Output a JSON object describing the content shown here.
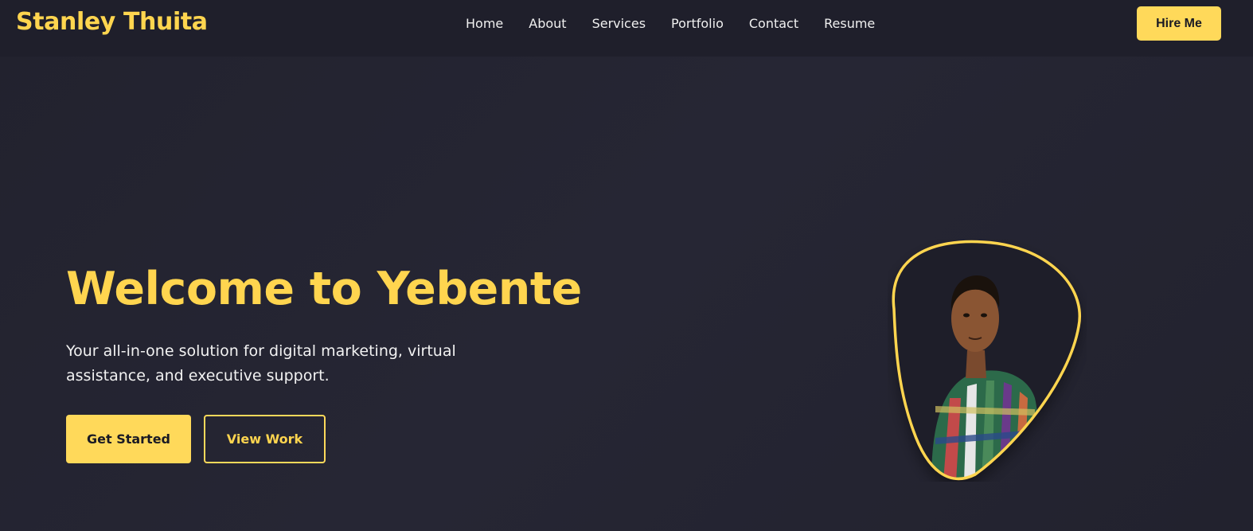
{
  "brand": {
    "name": "Stanley Thuita"
  },
  "nav": {
    "items": [
      {
        "label": "Home"
      },
      {
        "label": "About"
      },
      {
        "label": "Services"
      },
      {
        "label": "Portfolio"
      },
      {
        "label": "Contact"
      },
      {
        "label": "Resume"
      }
    ],
    "cta_label": "Hire Me"
  },
  "hero": {
    "title": "Welcome to Yebente",
    "subtitle": "Your all-in-one solution for digital marketing, virtual assistance, and executive support.",
    "primary_button": "Get Started",
    "secondary_button": "View Work"
  },
  "colors": {
    "accent": "#ffd54f",
    "background": "#23232f",
    "header": "#1f1f2b"
  }
}
